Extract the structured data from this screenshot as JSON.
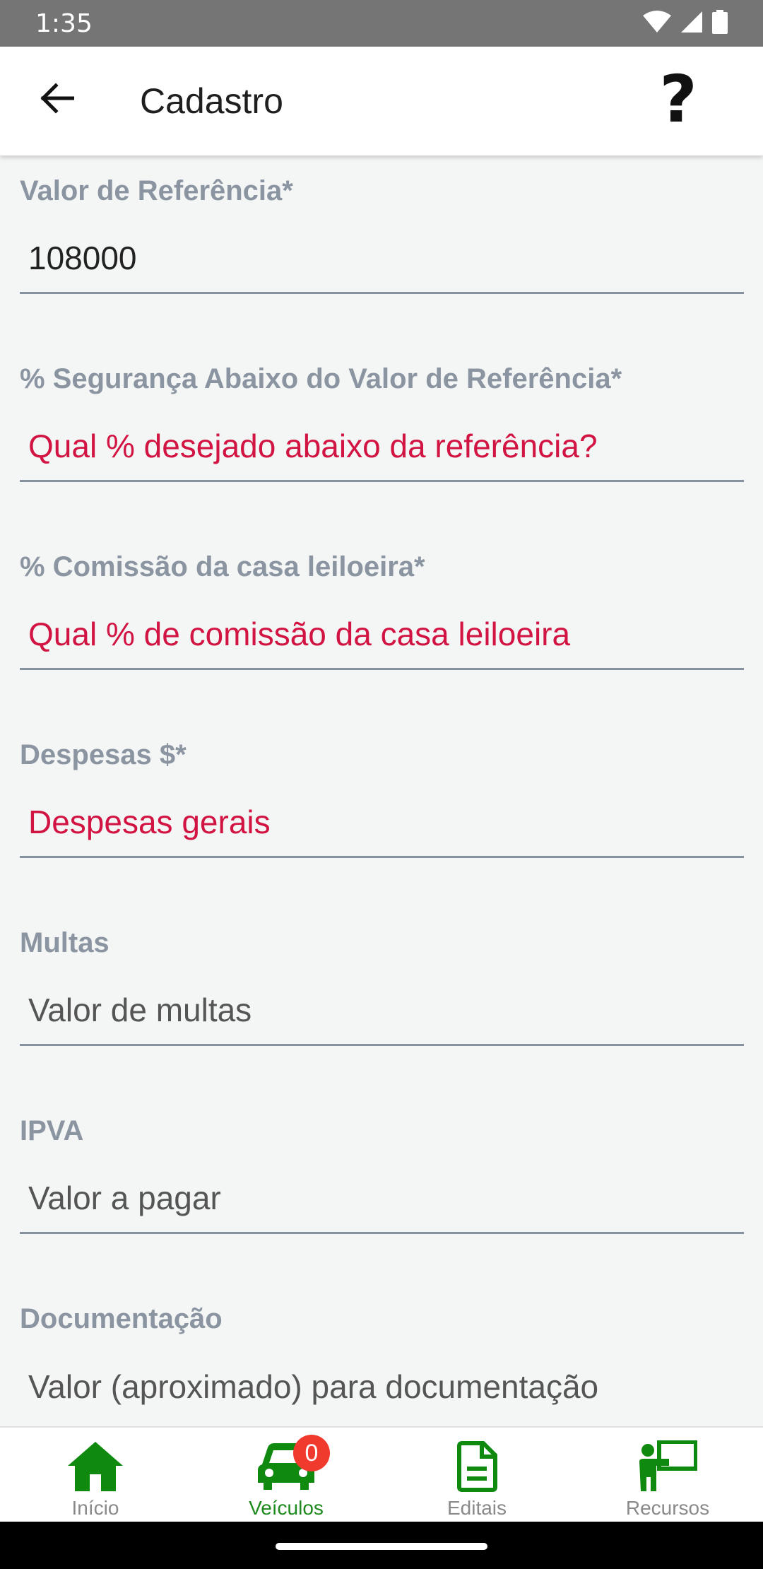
{
  "status_bar": {
    "time": "1:35"
  },
  "app_bar": {
    "title": "Cadastro",
    "help_label": "?"
  },
  "form": {
    "fields": [
      {
        "label": "Valor de Referência*",
        "value": "108000",
        "placeholder": ""
      },
      {
        "label": "% Segurança Abaixo do Valor de Referência*",
        "value": "",
        "placeholder": "Qual % desejado abaixo da referência?"
      },
      {
        "label": "% Comissão da casa leiloeira*",
        "value": "",
        "placeholder": "Qual % de comissão da casa leiloeira"
      },
      {
        "label": "Despesas $*",
        "value": "",
        "placeholder": "Despesas gerais"
      },
      {
        "label": "Multas",
        "value": "",
        "placeholder": "Valor de multas"
      },
      {
        "label": "IPVA",
        "value": "",
        "placeholder": "Valor a pagar"
      },
      {
        "label": "Documentação",
        "value": "",
        "placeholder": "Valor (aproximado) para documentação"
      }
    ]
  },
  "bottom_nav": {
    "items": [
      {
        "label": "Início",
        "icon": "home-icon"
      },
      {
        "label": "Veículos",
        "icon": "car-icon",
        "badge": "0",
        "active": true
      },
      {
        "label": "Editais",
        "icon": "document-icon"
      },
      {
        "label": "Recursos",
        "icon": "presenter-icon"
      }
    ]
  },
  "colors": {
    "accent_green": "#1e8a1e",
    "icon_green": "#0f8a0f",
    "required_placeholder": "#d21443",
    "label_gray": "#8b95a1",
    "badge_red": "#f03a2e",
    "status_bar": "#757575"
  }
}
